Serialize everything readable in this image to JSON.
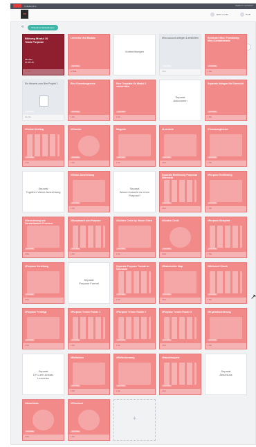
{
  "topbar": {
    "title": "Collaborative",
    "right": "Plattform verlassen"
  },
  "header": {
    "brand": "ON",
    "share": "Teilen / Invite",
    "user": "Profil"
  },
  "board": {
    "back": "«",
    "chip": "Teilnehmer-Einstellungen"
  },
  "cards": [
    {
      "style": "dark",
      "title": "Bildung Modul 10\nTeam Purpose",
      "date": "06/2022\n07-08 Uhr",
      "footer": "14 Teile"
    },
    {
      "style": "pink",
      "title": "Lernreise des Moduls",
      "tag": "Lernreise",
      "footer": "12 Teile"
    },
    {
      "style": "white",
      "center": "Vorbereitungen"
    },
    {
      "style": "gray",
      "title": "Miro account anlegen & einrichten",
      "tag": "Lernreise",
      "footer": "1 Teil"
    },
    {
      "style": "pink",
      "title": "Reminder Miro: Formatstep Miro-Kontaktdetails",
      "tag": "Lernreise",
      "footer": "1 Teil"
    },
    {
      "style": "gray",
      "title": "Ein Hinweis zum Bim Projekt 1",
      "doc": true,
      "tag": "Lernreise",
      "footer": "Nur Teil"
    },
    {
      "style": "pink",
      "title": "Eine Erwartungsreise",
      "tag": "Lernreise",
      "footer": "1 Teil"
    },
    {
      "style": "pink",
      "title": "Eine Template für Modul 2 vorbereiten",
      "tag": "Lernreise",
      "footer": "1 Teil"
    },
    {
      "style": "white",
      "center": "Separat\nAnkommen"
    },
    {
      "style": "pink",
      "title": "Separate Anlagen für Übersicht",
      "tag": "Lernreise",
      "footer": "1 Teil"
    },
    {
      "style": "pink",
      "title": "#Online Meeting",
      "thumb": "grid2",
      "tag": "Lernreise",
      "footer": "1 Teil"
    },
    {
      "style": "pink",
      "title": "#Checkin",
      "thumb": "circle",
      "tag": "Lernreise",
      "footer": "1 Teil"
    },
    {
      "style": "pink",
      "title": "Magnete",
      "thumb": "box",
      "tag": "Lernreise",
      "footer": "1 Teil"
    },
    {
      "style": "pink",
      "title": "#Lernziele",
      "thumb": "box",
      "tag": "Lernreise",
      "footer": "1 Teil"
    },
    {
      "style": "pink",
      "title": "#Teamausgleicher",
      "thumb": "box",
      "tag": "Lernreise",
      "footer": "1 Teil"
    },
    {
      "style": "white",
      "center": "Separat\nTogether Vision-Ausrichtung"
    },
    {
      "style": "pink",
      "title": "#Vision-Ausrichtung",
      "thumb": "box",
      "tag": "Lernreise",
      "footer": "1 Teil"
    },
    {
      "style": "white",
      "center": "Separat\nWarum braucht es einen Purpose?"
    },
    {
      "style": "pink",
      "title": "Separate Einführung Purposes Übersicht",
      "thumb": "grid2",
      "tag": "Lernreise",
      "footer": "1 Teil"
    },
    {
      "style": "pink",
      "title": "#Purpose Einführung",
      "thumb": "box",
      "tag": "Lernreise",
      "footer": "1 Teil"
    },
    {
      "style": "pink",
      "title": "#Generierung aus Vorstellbarkeit Prozesse",
      "thumb": "box",
      "tag": "Lernreise",
      "footer": "1 Teil"
    },
    {
      "style": "pink",
      "title": "#Storyboard zum Purpose",
      "thumb": "grid2",
      "tag": "Lernreise",
      "footer": "1 Teil"
    },
    {
      "style": "pink",
      "title": "#Golden Circle by Simon Sinek",
      "thumb": "box",
      "tag": "Lernreise",
      "footer": "1 Teil"
    },
    {
      "style": "pink",
      "title": "#Golden Circle",
      "thumb": "circle",
      "tag": "Lernreise",
      "footer": "1 Teil"
    },
    {
      "style": "pink",
      "title": "#Purpose-Beispiele",
      "thumb": "grid2",
      "tag": "Lernreise",
      "footer": "1 Teil"
    },
    {
      "style": "pink",
      "title": "#Purpose Herleitung",
      "thumb": "box",
      "tag": "Lernreise",
      "footer": "1 Teil"
    },
    {
      "style": "white",
      "center": "Separat\nPurpose Formel"
    },
    {
      "style": "pink",
      "title": "Separate Purpose Format zu Übersicht",
      "thumb": "grid2",
      "tag": "Lernreise",
      "footer": "1 Teil"
    },
    {
      "style": "pink",
      "title": "#Stakeholder Map",
      "thumb": "box",
      "tag": "Lernreise",
      "footer": "1 Teil"
    },
    {
      "style": "pink",
      "title": "#Mehrwert Check",
      "thumb": "grid2",
      "tag": "Lernreise",
      "footer": "1 Teil"
    },
    {
      "style": "pink",
      "title": "#Purpose Prototyp",
      "thumb": "box",
      "tag": "Lernreise",
      "footer": "1 Teil"
    },
    {
      "style": "pink",
      "title": "#Purpose Termin Runde 1",
      "thumb": "grid2",
      "tag": "Lernreise",
      "footer": "1 Teil"
    },
    {
      "style": "pink",
      "title": "#Purpose Termin Runde 2",
      "thumb": "grid2",
      "tag": "Lernreise",
      "footer": "1 Teil"
    },
    {
      "style": "pink",
      "title": "#Purpose Termin Runde 3",
      "thumb": "grid2",
      "tag": "Lernreise",
      "footer": "1 Teil"
    },
    {
      "style": "pink",
      "title": "#Ergebnissicherung",
      "thumb": "box",
      "tag": "Lernreise",
      "footer": "1 Teil"
    },
    {
      "style": "white",
      "center": "Separat\nDIY-Lern-Ansatz\nLernreise"
    },
    {
      "style": "pink",
      "title": "#Reflektion",
      "thumb": "box",
      "tag": "Lernreise",
      "footer": "1 Teil"
    },
    {
      "style": "pink",
      "title": "#Reflexionsweg",
      "thumb": "box",
      "tag": "Lernreise",
      "footer": "1 Teil"
    },
    {
      "style": "pink",
      "title": "#Handelsspiele",
      "thumb": "grid2",
      "tag": "Lernreise",
      "footer": "1 Teil"
    },
    {
      "style": "white",
      "center": "Separat\nAbschluss"
    },
    {
      "style": "pink",
      "title": "#Abschluss",
      "thumb": "circle",
      "tag": "Lernreise",
      "footer": "1 Teil"
    },
    {
      "style": "pink",
      "title": "#Checkout",
      "thumb": "circle",
      "tag": "Lernreise",
      "footer": "1 Teil"
    }
  ],
  "add_card": {
    "label": "+"
  },
  "cursor": "↗"
}
